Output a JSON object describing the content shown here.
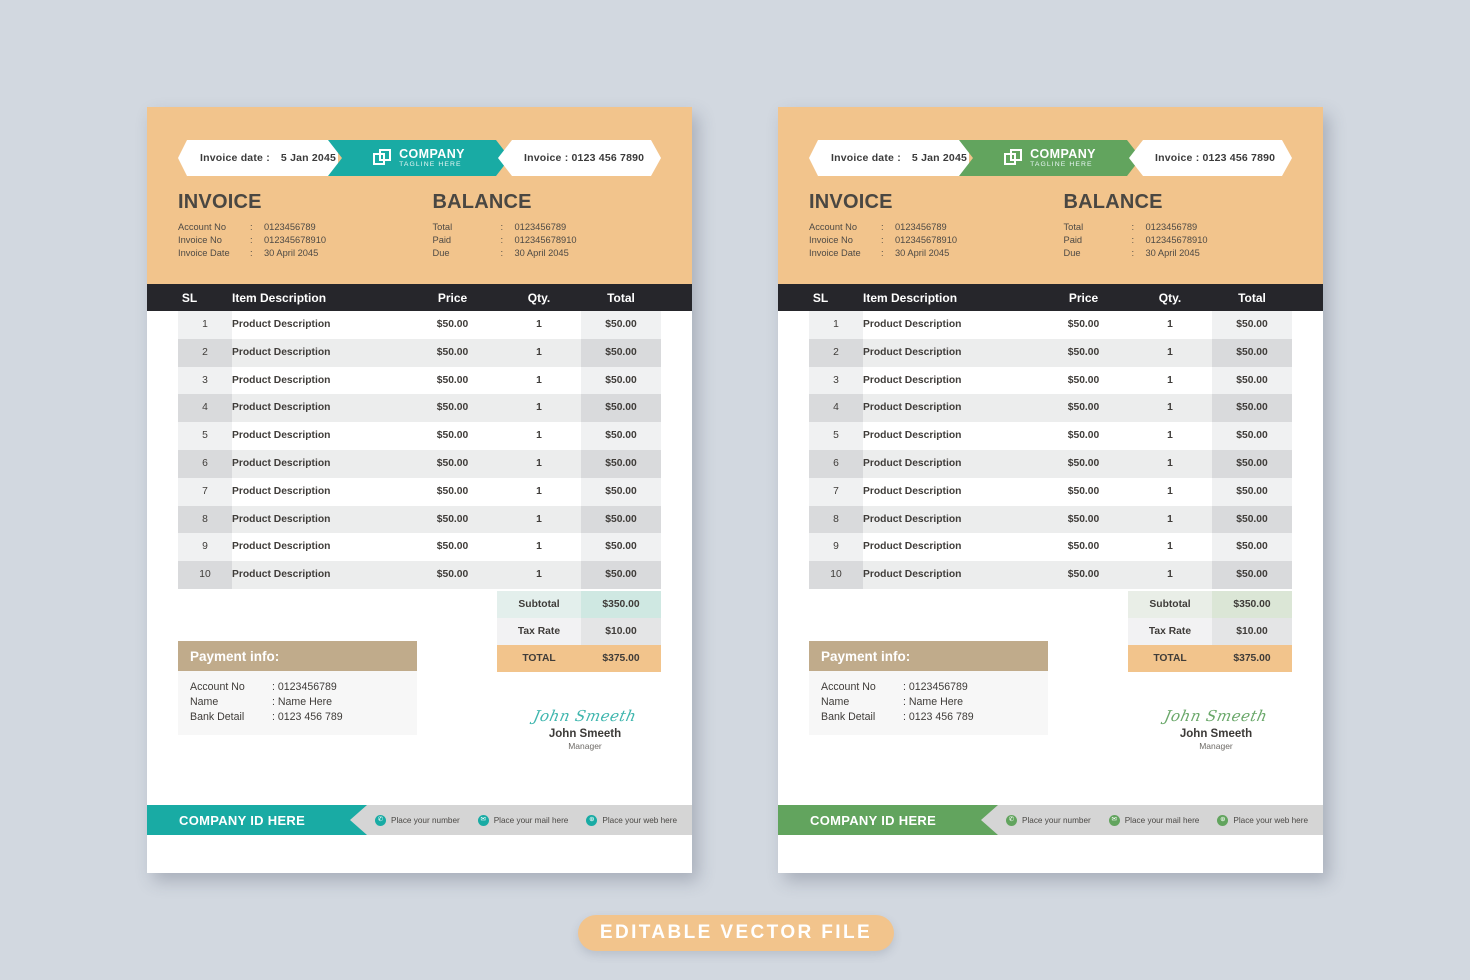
{
  "banner": {
    "label": "EDITABLE VECTOR  FILE"
  },
  "variants": [
    {
      "key": "teal",
      "accent": "#19ABA4"
    },
    {
      "key": "green",
      "accent": "#62a45e"
    }
  ],
  "ribbon": {
    "date_label": "Invoice date :",
    "date_value": "5 Jan 2045",
    "company_name": "COMPANY",
    "company_tagline": "TAGLINE HERE",
    "invoice_no": "Invoice : 0123 456 7890",
    "logo_icon": "overlapping-squares-icon"
  },
  "invoice_block": {
    "title": "INVOICE",
    "rows": [
      {
        "label": "Account No",
        "sep": ":",
        "value": "0123456789"
      },
      {
        "label": "Invoice No",
        "sep": ":",
        "value": "012345678910"
      },
      {
        "label": "Invoice Date",
        "sep": ":",
        "value": "30 April 2045"
      }
    ]
  },
  "balance_block": {
    "title": "BALANCE",
    "rows": [
      {
        "label": "Total",
        "sep": ":",
        "value": "0123456789"
      },
      {
        "label": "Paid",
        "sep": ":",
        "value": "012345678910"
      },
      {
        "label": "Due",
        "sep": ":",
        "value": "30 April 2045"
      }
    ]
  },
  "table": {
    "headers": [
      "SL",
      "Item Description",
      "Price",
      "Qty.",
      "Total"
    ],
    "rows": [
      {
        "sl": "1",
        "desc": "Product Description",
        "price": "$50.00",
        "qty": "1",
        "total": "$50.00"
      },
      {
        "sl": "2",
        "desc": "Product Description",
        "price": "$50.00",
        "qty": "1",
        "total": "$50.00"
      },
      {
        "sl": "3",
        "desc": "Product Description",
        "price": "$50.00",
        "qty": "1",
        "total": "$50.00"
      },
      {
        "sl": "4",
        "desc": "Product Description",
        "price": "$50.00",
        "qty": "1",
        "total": "$50.00"
      },
      {
        "sl": "5",
        "desc": "Product Description",
        "price": "$50.00",
        "qty": "1",
        "total": "$50.00"
      },
      {
        "sl": "6",
        "desc": "Product Description",
        "price": "$50.00",
        "qty": "1",
        "total": "$50.00"
      },
      {
        "sl": "7",
        "desc": "Product Description",
        "price": "$50.00",
        "qty": "1",
        "total": "$50.00"
      },
      {
        "sl": "8",
        "desc": "Product Description",
        "price": "$50.00",
        "qty": "1",
        "total": "$50.00"
      },
      {
        "sl": "9",
        "desc": "Product Description",
        "price": "$50.00",
        "qty": "1",
        "total": "$50.00"
      },
      {
        "sl": "10",
        "desc": "Product Description",
        "price": "$50.00",
        "qty": "1",
        "total": "$50.00"
      }
    ]
  },
  "totals": [
    {
      "label": "Subtotal",
      "value": "$350.00",
      "kind": "sub"
    },
    {
      "label": "Tax Rate",
      "value": "$10.00",
      "kind": "tax"
    },
    {
      "label": "TOTAL",
      "value": "$375.00",
      "kind": "grand"
    }
  ],
  "payment": {
    "title": "Payment info:",
    "rows": [
      {
        "label": "Account No",
        "value": ": 0123456789"
      },
      {
        "label": "Name",
        "value": ": Name Here"
      },
      {
        "label": "Bank Detail",
        "value": ": 0123 456 789"
      }
    ]
  },
  "signature": {
    "script": "John Smeeth",
    "name": "John Smeeth",
    "role": "Manager"
  },
  "footer": {
    "company_id": "COMPANY ID HERE",
    "items": [
      {
        "icon": "phone-icon",
        "glyph": "✆",
        "text": "Place your number"
      },
      {
        "icon": "mail-icon",
        "glyph": "✉",
        "text": "Place your mail here"
      },
      {
        "icon": "globe-icon",
        "glyph": "⊕",
        "text": "Place your web here"
      }
    ]
  }
}
